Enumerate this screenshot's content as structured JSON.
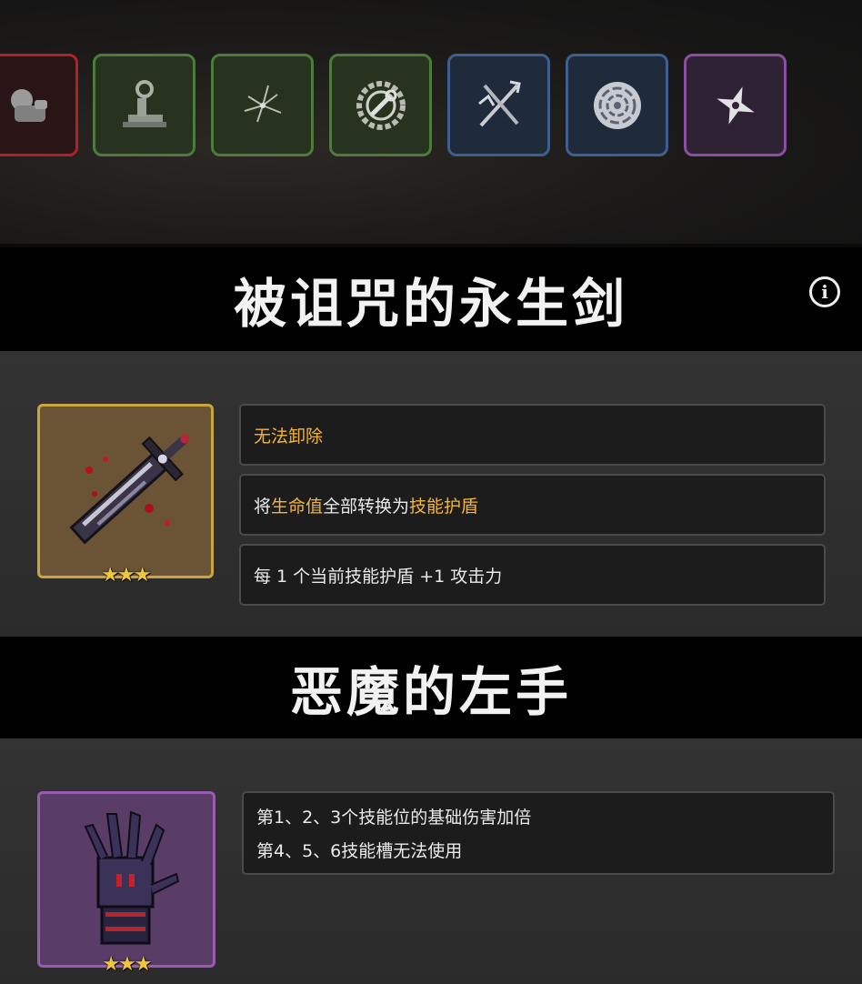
{
  "slots": [
    {
      "name": "fist-icon",
      "color": "red"
    },
    {
      "name": "anvil-icon",
      "color": "green"
    },
    {
      "name": "crack-icon",
      "color": "green"
    },
    {
      "name": "gear-wrench-icon",
      "color": "green"
    },
    {
      "name": "crossed-weapons-icon",
      "color": "blue"
    },
    {
      "name": "vortex-icon",
      "color": "blue"
    },
    {
      "name": "shuriken-icon",
      "color": "purple"
    }
  ],
  "colors": {
    "highlight": "#f2b53a",
    "gold_frame": "#c9a640",
    "violet_frame": "#9b5bb3"
  },
  "item1": {
    "title": "被诅咒的永生剑",
    "stars": "★★★",
    "desc1": "无法卸除",
    "desc2": {
      "a": "将",
      "b": "生命值",
      "c": "全部转换为",
      "d": "技能护盾"
    },
    "desc3": "每 1 个当前技能护盾 +1 攻击力"
  },
  "item2": {
    "title": "恶魔的左手",
    "stars": "★★★",
    "line1": "第1、2、3个技能位的基础伤害加倍",
    "line2": "第4、5、6技能槽无法使用"
  }
}
